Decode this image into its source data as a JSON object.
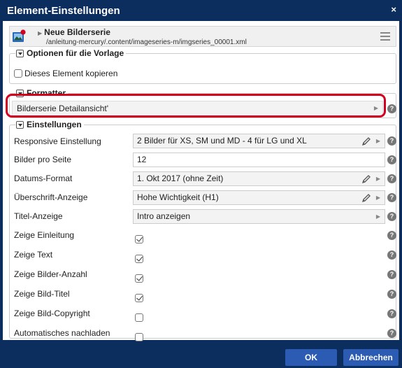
{
  "dialog": {
    "title": "Element-Einstellungen",
    "close_label": "×"
  },
  "resource": {
    "title": "Neue Bilderserie",
    "path": "/anleitung-mercury/.content/imageseries-m/imgseries_00001.xml"
  },
  "groups": {
    "optionen": {
      "legend": "Optionen für die Vorlage",
      "copy_label": "Dieses Element kopieren",
      "copy_checked": false
    },
    "formatter": {
      "legend": "Formatter",
      "value": "Bilderserie Detailansicht'"
    },
    "einstellungen": {
      "legend": "Einstellungen",
      "rows": [
        {
          "label": "Responsive Einstellung",
          "type": "select",
          "value": "2 Bilder für XS, SM und MD - 4 für LG und XL",
          "editable": true
        },
        {
          "label": "Bilder pro Seite",
          "type": "input",
          "value": "12"
        },
        {
          "label": "Datums-Format",
          "type": "select",
          "value": "1. Okt 2017 (ohne Zeit)",
          "editable": true
        },
        {
          "label": "Überschrift-Anzeige",
          "type": "select",
          "value": "Hohe Wichtigkeit (H1)",
          "editable": true
        },
        {
          "label": "Titel-Anzeige",
          "type": "select",
          "value": "Intro anzeigen",
          "editable": false
        },
        {
          "label": "Zeige Einleitung",
          "type": "checkbox",
          "checked": true
        },
        {
          "label": "Zeige Text",
          "type": "checkbox",
          "checked": true
        },
        {
          "label": "Zeige Bilder-Anzahl",
          "type": "checkbox",
          "checked": true
        },
        {
          "label": "Zeige Bild-Titel",
          "type": "checkbox",
          "checked": true
        },
        {
          "label": "Zeige Bild-Copyright",
          "type": "checkbox",
          "checked": false
        },
        {
          "label": "Automatisches nachladen",
          "type": "checkbox",
          "checked": false
        }
      ]
    }
  },
  "footer": {
    "ok_label": "OK",
    "cancel_label": "Abbrechen"
  },
  "icons": {
    "help": "?",
    "chevron": "▶"
  },
  "colors": {
    "titlebar": "#0b2e5e",
    "button": "#2c5bb3",
    "highlight": "#d2001f"
  }
}
